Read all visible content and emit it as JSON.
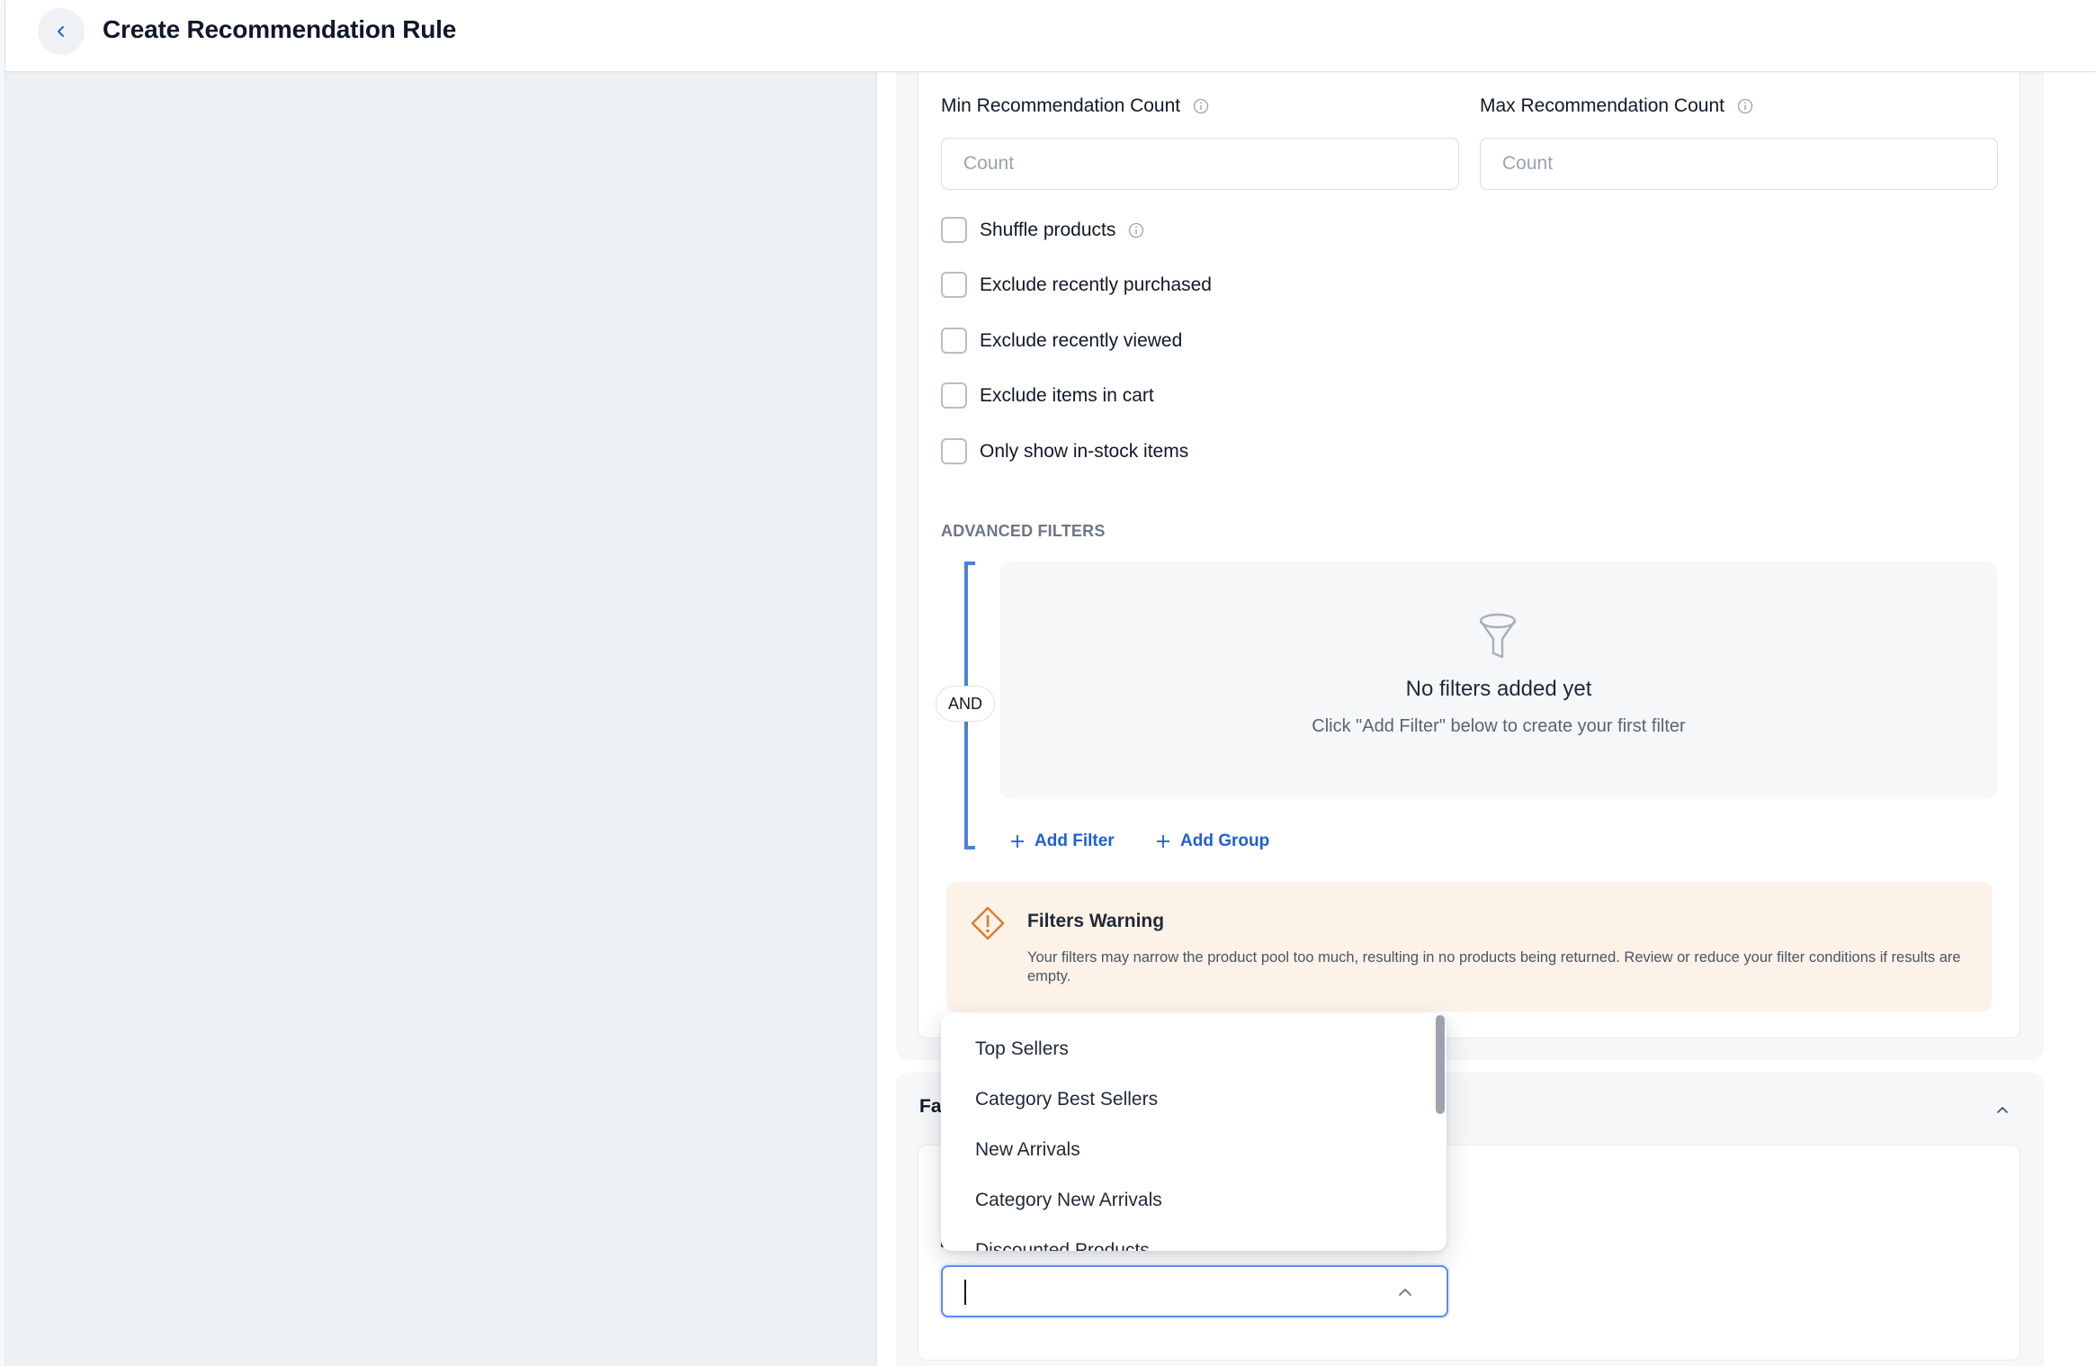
{
  "header": {
    "title": "Create Recommendation Rule",
    "back_icon": "chevron-left-icon"
  },
  "counts": {
    "min_label": "Min Recommendation Count",
    "max_label": "Max Recommendation Count",
    "min_placeholder": "Count",
    "max_placeholder": "Count",
    "min_value": "",
    "max_value": ""
  },
  "options": [
    {
      "label": "Shuffle products",
      "checked": false,
      "info": true
    },
    {
      "label": "Exclude recently purchased",
      "checked": false
    },
    {
      "label": "Exclude recently viewed",
      "checked": false
    },
    {
      "label": "Exclude items in cart",
      "checked": false
    },
    {
      "label": "Only show in-stock items",
      "checked": false
    }
  ],
  "advanced_filters": {
    "title": "ADVANCED FILTERS",
    "operator": "AND",
    "empty_title": "No filters added yet",
    "empty_subtitle": "Click \"Add Filter\" below to create your first filter",
    "add_filter": "Add Filter",
    "add_group": "Add Group",
    "accent_color": "#4a7fe0"
  },
  "warning": {
    "title": "Filters Warning",
    "text": "Your filters may narrow the product pool too much, resulting in no products being returned. Review or reduce your filter conditions if results are empty.",
    "color": "#e07b2a"
  },
  "section2": {
    "title_visible": "Fa"
  },
  "dropdown": {
    "items": [
      "Top Sellers",
      "Category Best Sellers",
      "New Arrivals",
      "Category New Arrivals",
      "Discounted Products"
    ],
    "selected_value": ""
  }
}
